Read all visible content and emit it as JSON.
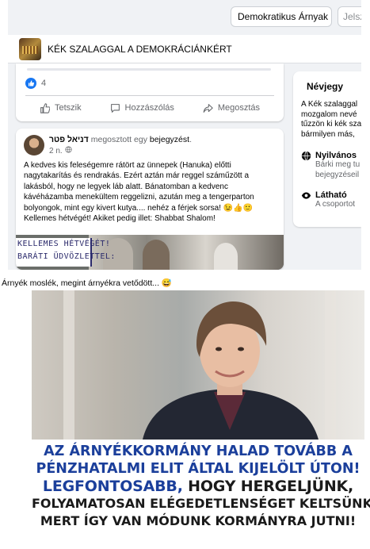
{
  "header": {
    "group_selector_value": "Demokratikus Árnyak",
    "search_placeholder": "Jelsz"
  },
  "group": {
    "name": "KÉK SZALAGGAL A DEMOKRÁCIÁNKÉRT"
  },
  "first_post": {
    "like_count": "4",
    "actions": {
      "like": "Tetszik",
      "comment": "Hozzászólás",
      "share": "Megosztás"
    }
  },
  "second_post": {
    "author": "דניאל פטר",
    "shared_text": "megosztott egy",
    "shared_link": "bejegyzést",
    "time": "2 n.",
    "body": "A kedves kis feleségemre rátört az ünnepek (Hanuka) előtti nagytakarítás és rendrakás. Ezért aztán már reggel száműzött a lakásból, hogy ne legyek láb alatt. Bánatomban a kedvenc kávéházamba menekültem reggelizni, azután meg a tengerparton bolyongok, mint egy kivert kutya.... nehéz a férjek sorsa! 😉👍🙂 Kellemes hétvégét! Akiket pedig illet: Shabbat Shalom!",
    "image_banner": [
      "KELLEMES HÉTVÉGÉT!",
      "BARÁTI ÜDVÖZLETTEL:"
    ]
  },
  "sidebar": {
    "title": "Névjegy",
    "description": "A Kék szalaggal mozgalom nevé tűzzön ki kék sza bármilyen más, ",
    "privacy": {
      "label": "Nyilvános",
      "sub": "Bárki meg tu bejegyzéseil"
    },
    "visibility": {
      "label": "Látható",
      "sub": "A csoportot"
    }
  },
  "caption": "Árnyék moslék, megint árnyékra vetődött... 😅",
  "ad": {
    "line1": "AZ ÁRNYÉKKORMÁNY HALAD TOVÁBB A",
    "line2": "PÉNZHATALMI ELIT ÁLTAL KIJELÖLT ÚTON!",
    "line3_highlight": "LEGFONTOSABB,",
    "line3_rest": " HOGY HERGELJÜNK,",
    "line4": "FOLYAMATOSAN ELÉGEDETLENSÉGET KELTSÜNK,",
    "line5": "MERT ÍGY VAN MÓDUNK KORMÁNYRA JUTNI!"
  },
  "colors": {
    "facebook_blue": "#1877f2",
    "ad_blue": "#1b3f9b",
    "page_bg": "#f0f2f5"
  },
  "icons": [
    "like-icon",
    "comment-icon",
    "share-icon",
    "globe-icon",
    "eye-icon"
  ]
}
